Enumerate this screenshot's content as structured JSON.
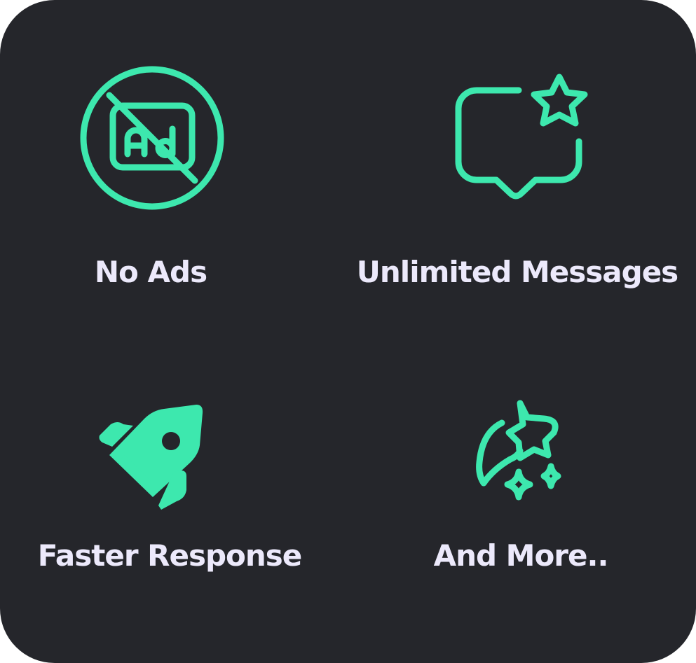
{
  "theme": {
    "background": "#25262b",
    "accent": "#3de8ae",
    "label_color": "#ece9fb"
  },
  "features": [
    {
      "label": "No Ads",
      "icon": "no-ads-icon"
    },
    {
      "label": "Unlimited Messages",
      "icon": "message-star-icon"
    },
    {
      "label": "Faster Response",
      "icon": "rocket-icon"
    },
    {
      "label": "And More..",
      "icon": "moon-stars-icon"
    }
  ]
}
